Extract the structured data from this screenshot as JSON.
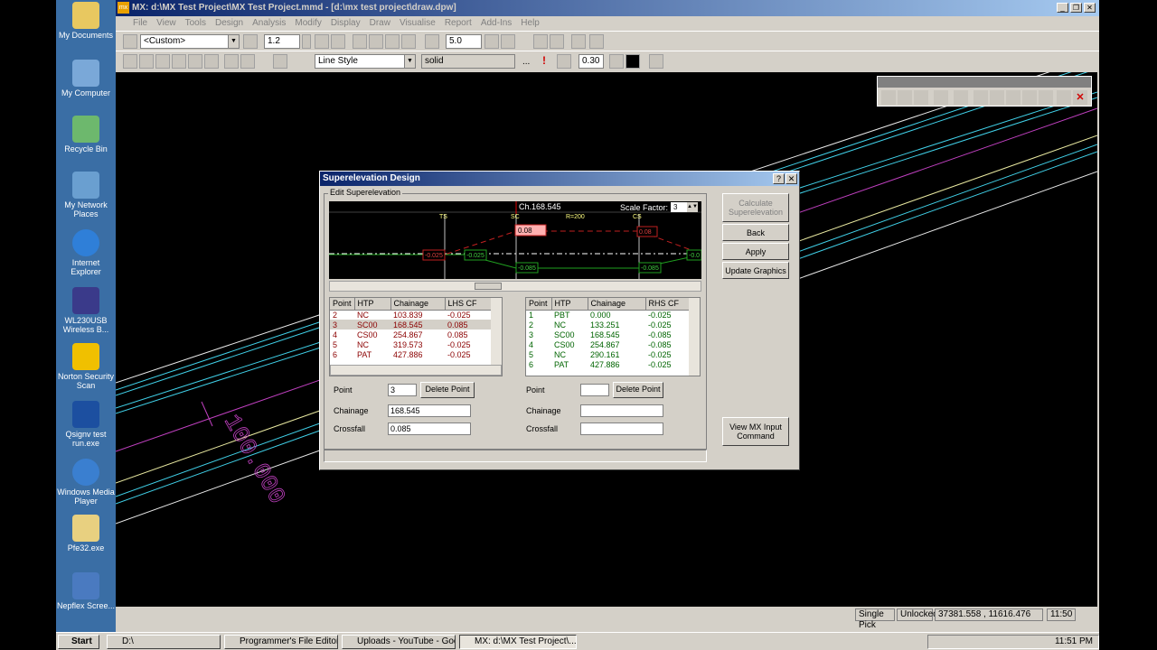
{
  "desktop": {
    "icons": [
      {
        "label": "My Documents",
        "color": "#e8c860"
      },
      {
        "label": "My Computer",
        "color": "#7aa8d8"
      },
      {
        "label": "Recycle Bin",
        "color": "#6db86d"
      },
      {
        "label": "My Network Places",
        "color": "#6a9fd0"
      },
      {
        "label": "Internet Explorer",
        "color": "#2f7fd8"
      },
      {
        "label": "WL230USB Wireless B...",
        "color": "#3a3a8a"
      },
      {
        "label": "Norton Security Scan",
        "color": "#f0c000"
      },
      {
        "label": "Qsignv test run.exe",
        "color": "#1c4fa0"
      },
      {
        "label": "Windows Media Player",
        "color": "#3a7fd0"
      },
      {
        "label": "Pfe32.exe",
        "color": "#e8d080"
      },
      {
        "label": "Nepflex Scree...",
        "color": "#4a7ac0"
      }
    ]
  },
  "app": {
    "title": "MX: d:\\MX Test Project\\MX Test Project.mmd - [d:\\mx test project\\draw.dpw]",
    "logo": "mx",
    "menu": [
      "File",
      "View",
      "Tools",
      "Design",
      "Analysis",
      "Modify",
      "Display",
      "Draw",
      "Visualise",
      "Report",
      "Add-Ins",
      "Help"
    ],
    "toolbar": {
      "custom": "<Custom>",
      "scale": "1.2",
      "zoom": "5.0",
      "linestyle": "Line Style",
      "linetype": "solid",
      "dots": "...",
      "width": "0.30"
    }
  },
  "drawing": {
    "annotation": "100.000"
  },
  "status": {
    "pick": "Single Pick",
    "lock": "Unlocked",
    "coords": "37381.558 , 11616.476",
    "time": "11:50"
  },
  "taskbar": {
    "start": "Start",
    "items": [
      "D:\\",
      "Programmer's File Editor",
      "Uploads - YouTube - Goo...",
      "MX: d:\\MX Test Project\\..."
    ],
    "clock": "11:51 PM"
  },
  "dialog": {
    "title": "Superelevation Design",
    "help": "?",
    "close": "✕",
    "group": "Edit Superelevation",
    "graph": {
      "chainage": "Ch.168.545",
      "scale_label": "Scale Factor:",
      "scale": "3",
      "ts": "TS",
      "sc": "SC",
      "radius": "R=200",
      "cs": "CS",
      "labels": [
        "0.08",
        "-0.025",
        "-0.025",
        "-0.085",
        "0.08",
        "-0.085",
        "-0.0"
      ]
    },
    "left_table": {
      "headers": [
        "Point",
        "HTP",
        "Chainage",
        "LHS CF"
      ],
      "rows": [
        [
          "2",
          "NC",
          "103.839",
          "-0.025"
        ],
        [
          "3",
          "SC00",
          "168.545",
          "0.085"
        ],
        [
          "4",
          "CS00",
          "254.867",
          "0.085"
        ],
        [
          "5",
          "NC",
          "319.573",
          "-0.025"
        ],
        [
          "6",
          "PAT",
          "427.886",
          "-0.025"
        ]
      ]
    },
    "right_table": {
      "headers": [
        "Point",
        "HTP",
        "Chainage",
        "RHS CF"
      ],
      "rows": [
        [
          "1",
          "PBT",
          "0.000",
          "-0.025"
        ],
        [
          "2",
          "NC",
          "133.251",
          "-0.025"
        ],
        [
          "3",
          "SC00",
          "168.545",
          "-0.085"
        ],
        [
          "4",
          "CS00",
          "254.867",
          "-0.085"
        ],
        [
          "5",
          "NC",
          "290.161",
          "-0.025"
        ],
        [
          "6",
          "PAT",
          "427.886",
          "-0.025"
        ]
      ]
    },
    "left_form": {
      "point_label": "Point",
      "point": "3",
      "delete": "Delete Point",
      "chainage_label": "Chainage",
      "chainage": "168.545",
      "crossfall_label": "Crossfall",
      "crossfall": "0.085"
    },
    "right_form": {
      "point_label": "Point",
      "point": "",
      "delete": "Delete Point",
      "chainage_label": "Chainage",
      "chainage": "",
      "crossfall_label": "Crossfall",
      "crossfall": ""
    },
    "buttons": {
      "calculate": "Calculate Superelevation",
      "back": "Back",
      "apply": "Apply",
      "update": "Update Graphics",
      "view": "View MX Input Command"
    }
  }
}
